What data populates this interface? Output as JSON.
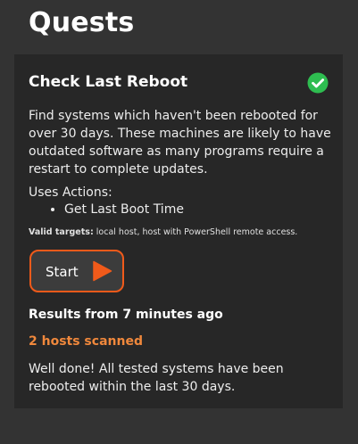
{
  "page": {
    "title": "Quests"
  },
  "quest": {
    "title": "Check Last Reboot",
    "status_icon": "check-circle-icon",
    "status_color": "#2ebd50",
    "description": "Find systems which haven't been rebooted for over 30 days. These machines are likely to have outdated software as many programs require a restart to complete updates.",
    "uses_actions_label": "Uses Actions:",
    "actions": [
      "Get Last Boot Time"
    ],
    "valid_targets_label": "Valid targets:",
    "valid_targets_text": "local host, host with PowerShell remote access.",
    "start_button": {
      "label": "Start",
      "icon": "play-icon",
      "accent_color": "#f05a1a"
    },
    "results": {
      "heading": "Results from 7 minutes ago",
      "hosts_scanned": "2 hosts scanned",
      "hosts_scanned_color": "#f0883c",
      "message": "Well done! All tested systems have been rebooted within the last 30 days."
    }
  }
}
